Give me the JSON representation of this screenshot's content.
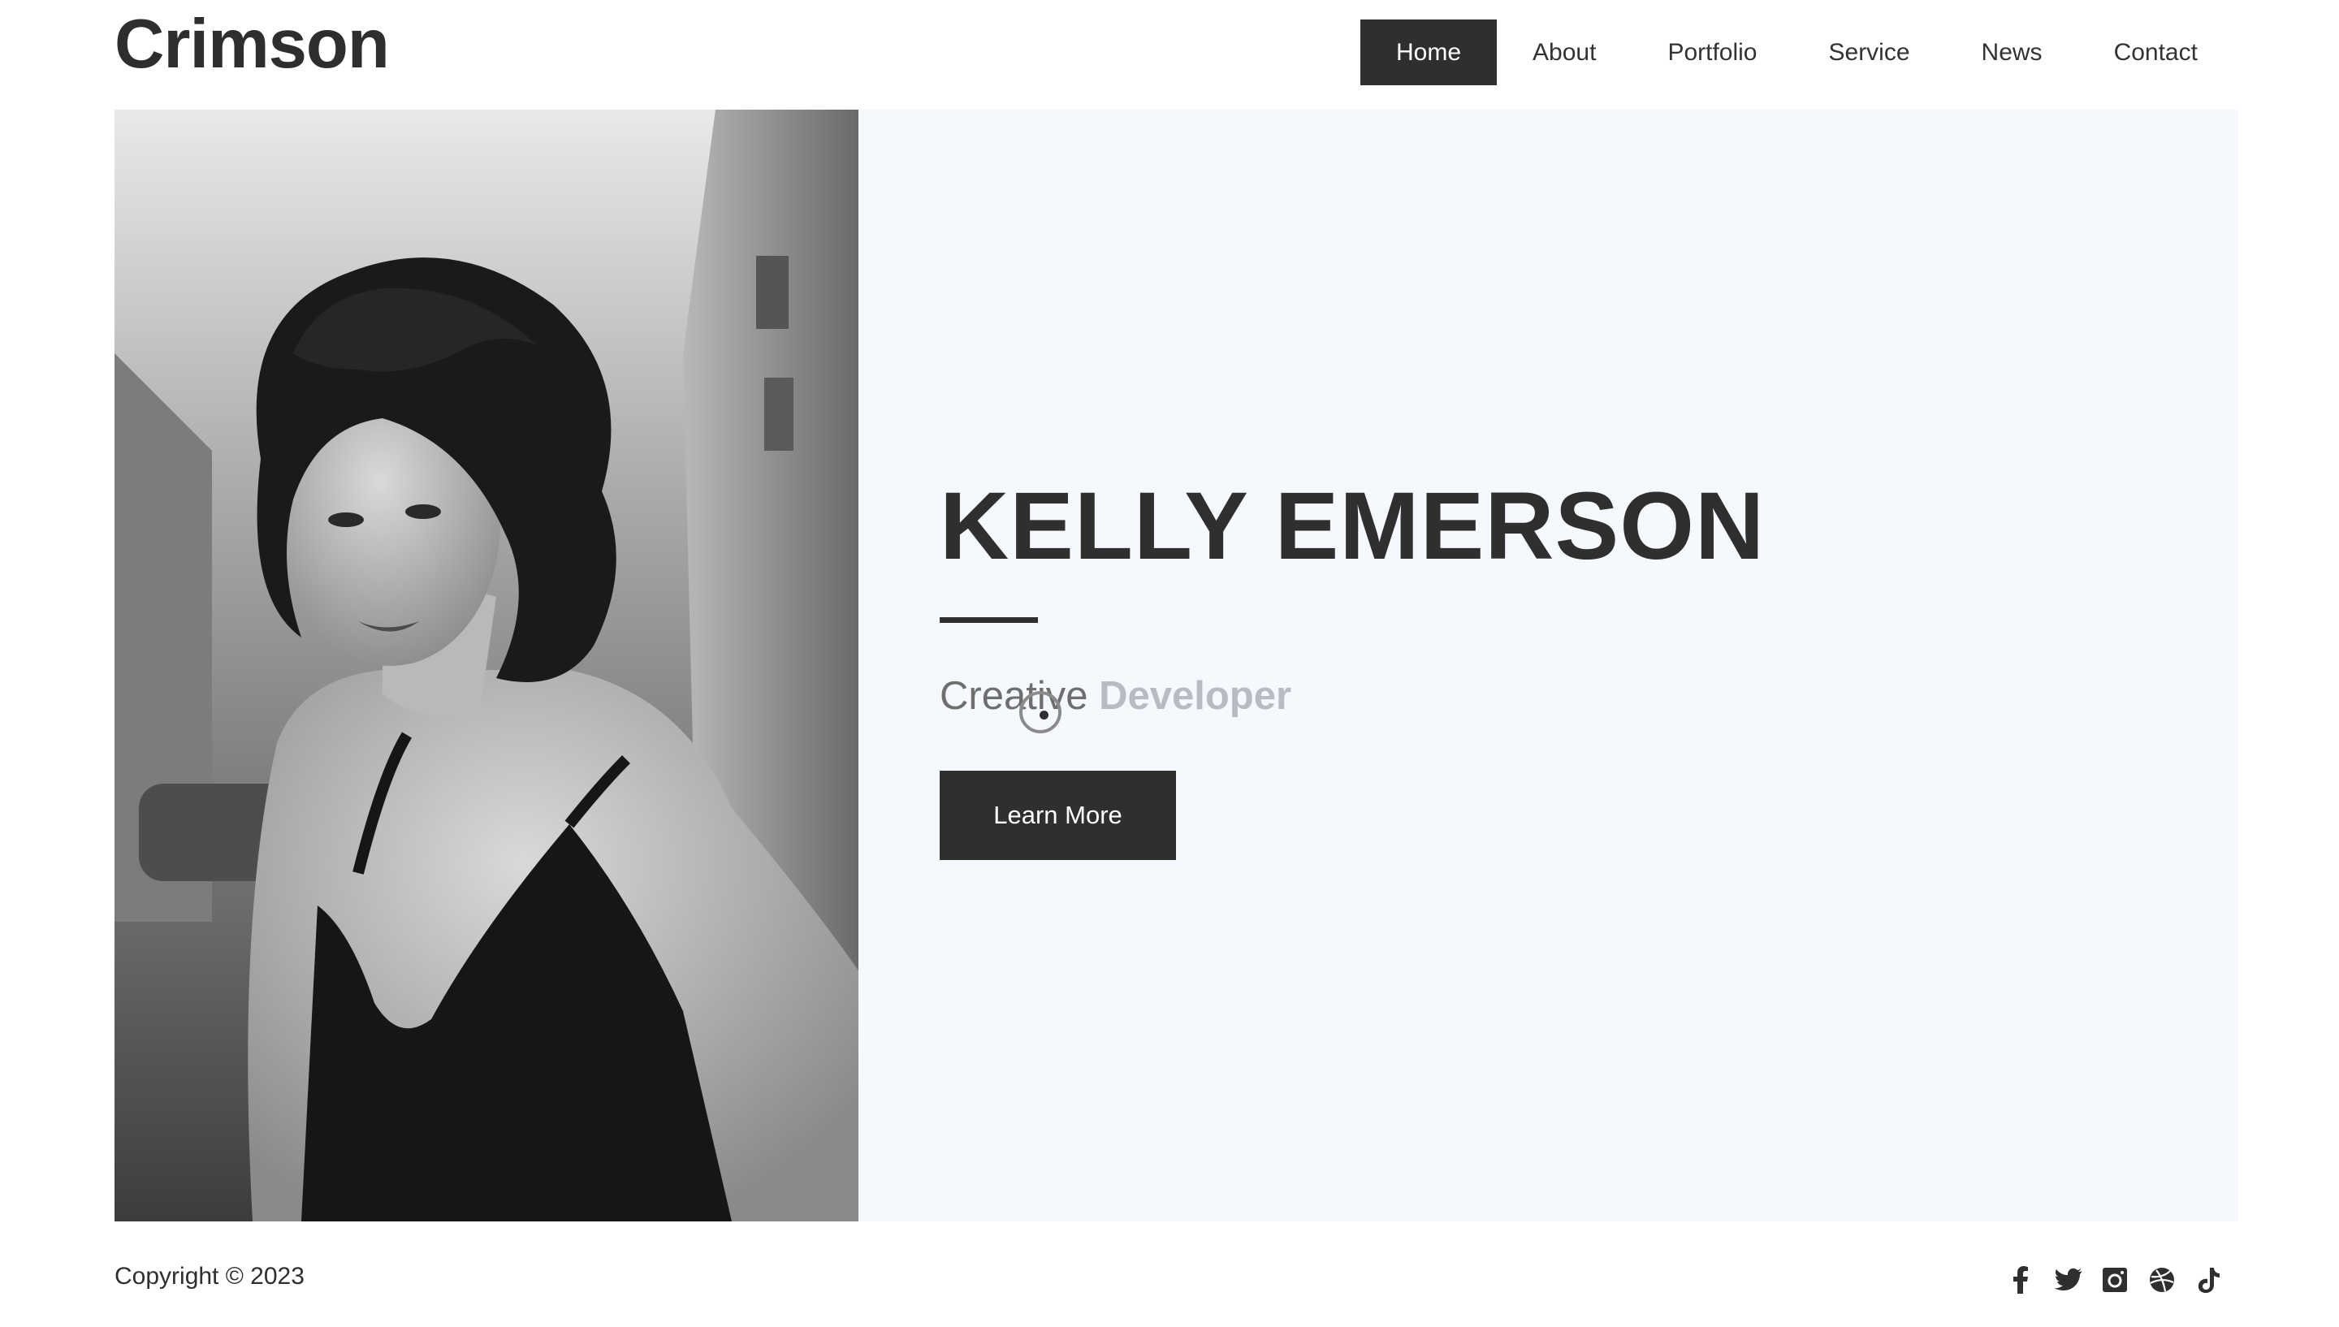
{
  "header": {
    "logo": "Crimson",
    "nav": [
      {
        "label": "Home",
        "active": true
      },
      {
        "label": "About"
      },
      {
        "label": "Portfolio"
      },
      {
        "label": "Service"
      },
      {
        "label": "News"
      },
      {
        "label": "Contact"
      }
    ]
  },
  "hero": {
    "image": {
      "alt": "Black and white portrait of a woman with curly hair"
    },
    "name": "KELLY EMERSON",
    "subtitle_static": "Creative",
    "subtitle_typed": "Developer",
    "cta_label": "Learn More"
  },
  "footer": {
    "copyright": "Copyright © 2023",
    "social": [
      "facebook-icon",
      "twitter-icon",
      "instagram-icon",
      "dribbble-icon",
      "tiktok-icon"
    ]
  },
  "colors": {
    "accent": "#2f2f2f",
    "hero_background": "#f5f9fe",
    "subtitle_muted": "#b7bcc3"
  }
}
